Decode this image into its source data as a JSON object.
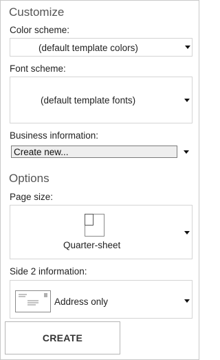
{
  "customize": {
    "title": "Customize",
    "color_scheme_label": "Color scheme:",
    "color_scheme_value": "(default template colors)",
    "font_scheme_label": "Font scheme:",
    "font_scheme_value": "(default template fonts)",
    "business_info_label": "Business information:",
    "business_info_value": "Create new..."
  },
  "options": {
    "title": "Options",
    "page_size_label": "Page size:",
    "page_size_value": "Quarter-sheet",
    "side2_label": "Side 2 information:",
    "side2_value": "Address only"
  },
  "actions": {
    "create_label": "CREATE"
  },
  "icons": {
    "page_size_thumbnail": "quarter-sheet-page-icon",
    "side2_thumbnail": "address-card-icon",
    "dropdown_arrow": "chevron-down-icon"
  }
}
